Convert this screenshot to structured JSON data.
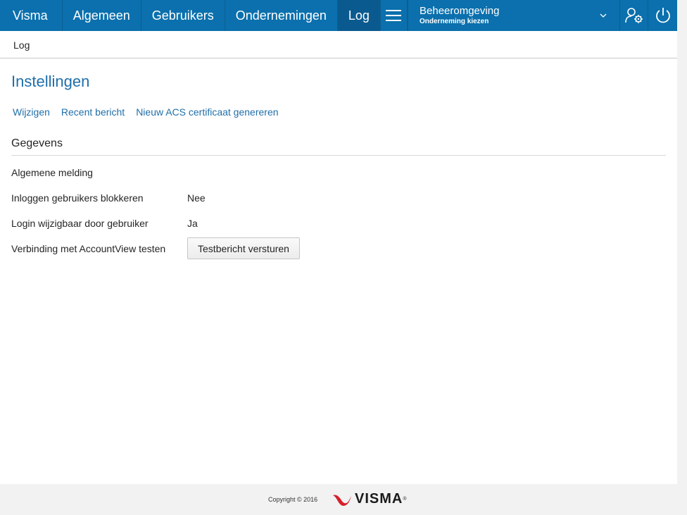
{
  "colors": {
    "nav_bg": "#0b70ad",
    "nav_active": "#0b5a8f",
    "link": "#1f6fa9",
    "brand_red": "#d61f2c"
  },
  "nav": {
    "brand": "Visma",
    "items": [
      {
        "label": "Algemeen"
      },
      {
        "label": "Gebruikers"
      },
      {
        "label": "Ondernemingen"
      },
      {
        "label": "Log",
        "active": true
      }
    ],
    "menu_icon": "hamburger-icon",
    "environment": {
      "title": "Beheeromgeving",
      "subtitle": "Onderneming kiezen",
      "icon": "chevron-down-icon"
    },
    "user_settings_icon": "user-settings-icon",
    "logout_icon": "power-icon"
  },
  "breadcrumb": {
    "label": "Log"
  },
  "page": {
    "title": "Instellingen",
    "actions": [
      "Wijzigen",
      "Recent bericht",
      "Nieuw ACS certificaat genereren"
    ],
    "section": "Gegevens",
    "fields": [
      {
        "label": "Algemene melding",
        "value": ""
      },
      {
        "label": "Inloggen gebruikers blokkeren",
        "value": "Nee"
      },
      {
        "label": "Login wijzigbaar door gebruiker",
        "value": "Ja"
      },
      {
        "label": "Verbinding met AccountView testen",
        "button": "Testbericht versturen"
      }
    ]
  },
  "footer": {
    "copyright": "Copyright © 2016",
    "logo_text": "VISMA",
    "logo_mark": "®"
  }
}
